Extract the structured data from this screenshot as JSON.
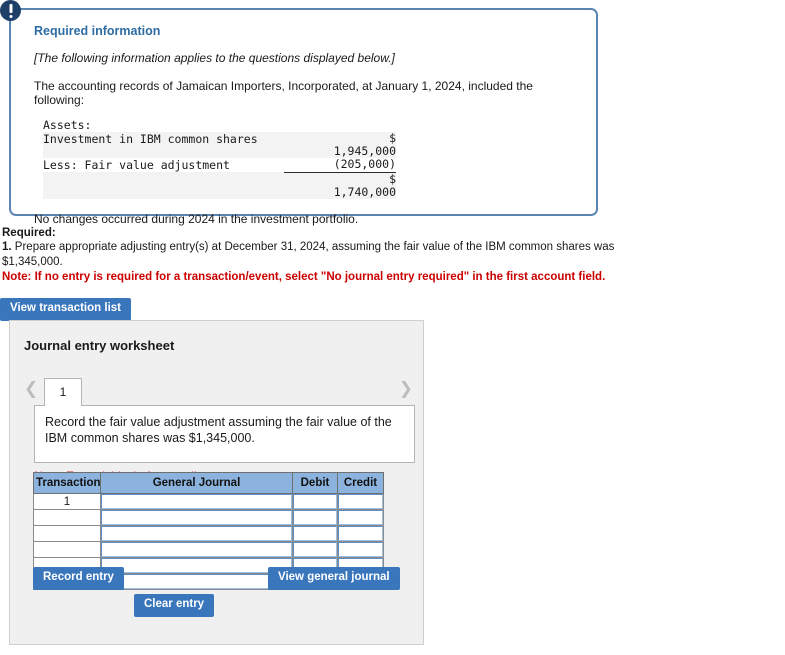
{
  "alert": {
    "icon": "exclamation-icon"
  },
  "required_information": {
    "heading": "Required information",
    "applies_note": "[The following information applies to the questions displayed below.]",
    "intro": "The accounting records of Jamaican Importers, Incorporated, at January 1, 2024, included the following:",
    "assets_table": {
      "section_label": "Assets:",
      "rows": [
        {
          "label": "Investment in IBM common shares",
          "currency": "$",
          "amount": "1,945,000"
        },
        {
          "label": "Less: Fair value adjustment",
          "currency": "",
          "amount": "(205,000)"
        },
        {
          "label": "",
          "currency": "$",
          "amount": "1,740,000"
        }
      ]
    },
    "closing_note": "No changes occurred during 2024 in the investment portfolio."
  },
  "required_block": {
    "label": "Required:",
    "item_number": "1.",
    "item_text": "Prepare appropriate adjusting entry(s) at December 31, 2024, assuming the fair value of the IBM common shares was $1,345,000.",
    "note": "Note: If no entry is required for a transaction/event, select \"No journal entry required\" in the first account field."
  },
  "view_transaction_list_label": "View transaction list",
  "worksheet": {
    "title": "Journal entry worksheet",
    "prev_icon": "chevron-left-icon",
    "next_icon": "chevron-right-icon",
    "active_tab": "1",
    "entry_description": "Record the fair value adjustment assuming the fair value of the IBM common shares was $1,345,000.",
    "debits_note": "Note: Enter debits before credits.",
    "table": {
      "columns": [
        "Transaction",
        "General Journal",
        "Debit",
        "Credit"
      ],
      "rows": [
        {
          "transaction": "1",
          "general_journal": "",
          "debit": "",
          "credit": ""
        },
        {
          "transaction": "",
          "general_journal": "",
          "debit": "",
          "credit": ""
        },
        {
          "transaction": "",
          "general_journal": "",
          "debit": "",
          "credit": ""
        },
        {
          "transaction": "",
          "general_journal": "",
          "debit": "",
          "credit": ""
        },
        {
          "transaction": "",
          "general_journal": "",
          "debit": "",
          "credit": ""
        },
        {
          "transaction": "",
          "general_journal": "",
          "debit": "",
          "credit": ""
        }
      ]
    },
    "record_entry_label": "Record entry",
    "clear_entry_label": "Clear entry",
    "view_general_journal_label": "View general journal"
  },
  "colors": {
    "panel_border": "#5b84b1",
    "heading_blue": "#2e6da4",
    "button_blue": "#3a76bc",
    "note_red": "#cc0000",
    "table_header_blue": "#8cb3dd",
    "badge_navy": "#1f3f69"
  }
}
